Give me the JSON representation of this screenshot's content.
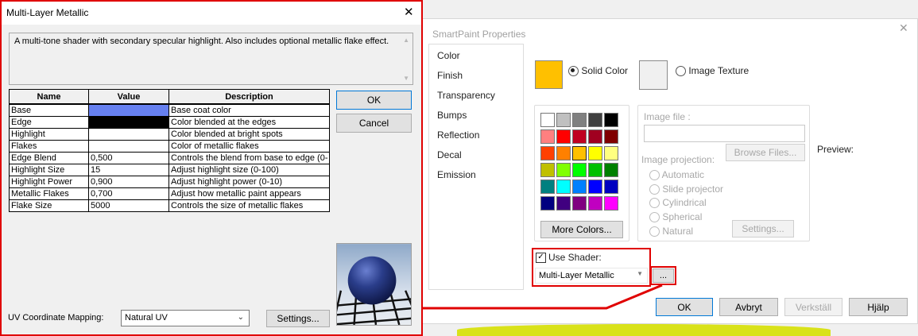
{
  "smartpaint": {
    "title": "SmartPaint Properties",
    "nav": [
      "Color",
      "Finish",
      "Transparency",
      "Bumps",
      "Reflection",
      "Decal",
      "Emission"
    ],
    "solid_color_label": "Solid Color",
    "image_texture_label": "Image Texture",
    "solid_color_value": "#ffc000",
    "image_file_label": "Image file :",
    "browse_label": "Browse Files...",
    "preview_label": "Preview:",
    "image_projection_label": "Image projection:",
    "projections": [
      "Automatic",
      "Slide projector",
      "Cylindrical",
      "Spherical",
      "Natural"
    ],
    "settings_label": "Settings...",
    "more_colors_label": "More Colors...",
    "use_shader_label": "Use Shader:",
    "shader_value": "Multi-Layer Metallic",
    "shader_dots": "...",
    "ok": "OK",
    "cancel": "Avbryt",
    "apply": "Verkställ",
    "help": "Hjälp",
    "palette": [
      [
        "#ffffff",
        "#c0c0c0",
        "#808080",
        "#404040",
        "#000000"
      ],
      [
        "#ff8080",
        "#ff0000",
        "#c00020",
        "#a00020",
        "#800000"
      ],
      [
        "#ff4000",
        "#ff8000",
        "#ffc000",
        "#ffff00",
        "#ffff80"
      ],
      [
        "#c0c000",
        "#80ff00",
        "#00ff00",
        "#00c000",
        "#008000"
      ],
      [
        "#008080",
        "#00ffff",
        "#0080ff",
        "#0000ff",
        "#0000c0"
      ],
      [
        "#000080",
        "#400080",
        "#800080",
        "#c000c0",
        "#ff00ff"
      ]
    ]
  },
  "shader_dialog": {
    "title": "Multi-Layer Metallic",
    "description": "A multi-tone shader with secondary specular highlight.  Also includes optional metallic flake effect.",
    "columns": [
      "Name",
      "Value",
      "Description"
    ],
    "rows": [
      {
        "name": "Base",
        "value": "",
        "color": "#6680f0",
        "desc": "Base coat color"
      },
      {
        "name": "Edge",
        "value": "",
        "color": "#000000",
        "desc": "Color blended at the edges"
      },
      {
        "name": "Highlight",
        "value": "",
        "color": "#ffffff",
        "desc": "Color blended at bright spots"
      },
      {
        "name": "Flakes",
        "value": "",
        "color": "#ffffff",
        "desc": "Color of metallic flakes"
      },
      {
        "name": "Edge Blend",
        "value": "0,500",
        "color": "",
        "desc": "Controls the blend from base to edge (0-"
      },
      {
        "name": "Highlight Size",
        "value": "15",
        "color": "",
        "desc": "Adjust highlight size (0-100)"
      },
      {
        "name": "Highlight Power",
        "value": "0,900",
        "color": "",
        "desc": "Adjust highlight power (0-10)"
      },
      {
        "name": "Metallic Flakes",
        "value": "0,700",
        "color": "",
        "desc": "Adjust how metallic paint appears"
      },
      {
        "name": "Flake Size",
        "value": "5000",
        "color": "",
        "desc": "Controls the size of metallic flakes"
      }
    ],
    "ok": "OK",
    "cancel": "Cancel",
    "uv_label": "UV Coordinate Mapping:",
    "uv_value": "Natural UV",
    "settings": "Settings..."
  },
  "colors": {
    "highlight_red": "#e00000",
    "accent_blue": "#0078d7"
  }
}
